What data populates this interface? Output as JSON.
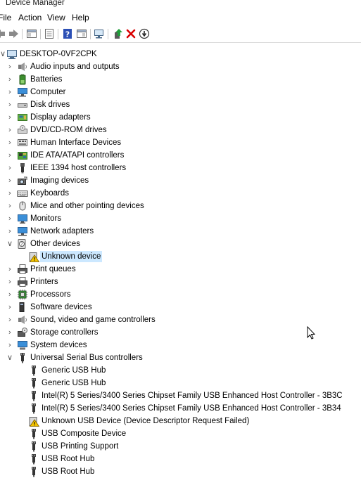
{
  "window": {
    "title": "Device Manager"
  },
  "menu": [
    "File",
    "Action",
    "View",
    "Help"
  ],
  "toolbar": {
    "icons": [
      "back-icon",
      "forward-icon",
      "show-hide-console-tree-icon",
      "properties-icon",
      "help-icon",
      "show-action-pane-icon",
      "scan-hardware-changes-icon",
      "update-driver-icon",
      "uninstall-device-icon",
      "disable-device-icon"
    ]
  },
  "tree": {
    "root": "DESKTOP-0VF2CPK",
    "categories": [
      {
        "label": "Audio inputs and outputs",
        "icon": "speaker-icon",
        "expanded": false
      },
      {
        "label": "Batteries",
        "icon": "battery-icon",
        "expanded": false
      },
      {
        "label": "Computer",
        "icon": "computer-icon",
        "expanded": false
      },
      {
        "label": "Disk drives",
        "icon": "disk-drive-icon",
        "expanded": false
      },
      {
        "label": "Display adapters",
        "icon": "display-adapter-icon",
        "expanded": false
      },
      {
        "label": "DVD/CD-ROM drives",
        "icon": "dvd-drive-icon",
        "expanded": false
      },
      {
        "label": "Human Interface Devices",
        "icon": "hid-icon",
        "expanded": false
      },
      {
        "label": "IDE ATA/ATAPI controllers",
        "icon": "ide-controller-icon",
        "expanded": false
      },
      {
        "label": "IEEE 1394 host controllers",
        "icon": "ieee1394-icon",
        "expanded": false
      },
      {
        "label": "Imaging devices",
        "icon": "camera-icon",
        "expanded": false
      },
      {
        "label": "Keyboards",
        "icon": "keyboard-icon",
        "expanded": false
      },
      {
        "label": "Mice and other pointing devices",
        "icon": "mouse-icon",
        "expanded": false
      },
      {
        "label": "Monitors",
        "icon": "monitor-icon",
        "expanded": false
      },
      {
        "label": "Network adapters",
        "icon": "network-adapter-icon",
        "expanded": false
      },
      {
        "label": "Other devices",
        "icon": "other-devices-icon",
        "expanded": true,
        "children": [
          {
            "label": "Unknown device",
            "icon": "warning-device-icon",
            "selected": true
          }
        ]
      },
      {
        "label": "Print queues",
        "icon": "printer-icon",
        "expanded": false
      },
      {
        "label": "Printers",
        "icon": "printer-icon",
        "expanded": false
      },
      {
        "label": "Processors",
        "icon": "processor-icon",
        "expanded": false
      },
      {
        "label": "Software devices",
        "icon": "software-device-icon",
        "expanded": false
      },
      {
        "label": "Sound, video and game controllers",
        "icon": "speaker-icon",
        "expanded": false
      },
      {
        "label": "Storage controllers",
        "icon": "storage-controller-icon",
        "expanded": false
      },
      {
        "label": "System devices",
        "icon": "system-device-icon",
        "expanded": false
      },
      {
        "label": "Universal Serial Bus controllers",
        "icon": "usb-icon",
        "expanded": true,
        "children": [
          {
            "label": "Generic USB Hub",
            "icon": "usb-icon"
          },
          {
            "label": "Generic USB Hub",
            "icon": "usb-icon"
          },
          {
            "label": "Intel(R) 5 Series/3400 Series Chipset Family USB Enhanced Host Controller - 3B3C",
            "icon": "usb-icon"
          },
          {
            "label": "Intel(R) 5 Series/3400 Series Chipset Family USB Enhanced Host Controller - 3B34",
            "icon": "usb-icon"
          },
          {
            "label": "Unknown USB Device (Device Descriptor Request Failed)",
            "icon": "warning-device-icon"
          },
          {
            "label": "USB Composite Device",
            "icon": "usb-icon"
          },
          {
            "label": "USB Printing Support",
            "icon": "usb-icon"
          },
          {
            "label": "USB Root Hub",
            "icon": "usb-icon"
          },
          {
            "label": "USB Root Hub",
            "icon": "usb-icon"
          }
        ]
      }
    ]
  },
  "colors": {
    "selection": "#cce8ff",
    "uninstall_red": "#d90000",
    "help_blue": "#2b4fb5"
  }
}
